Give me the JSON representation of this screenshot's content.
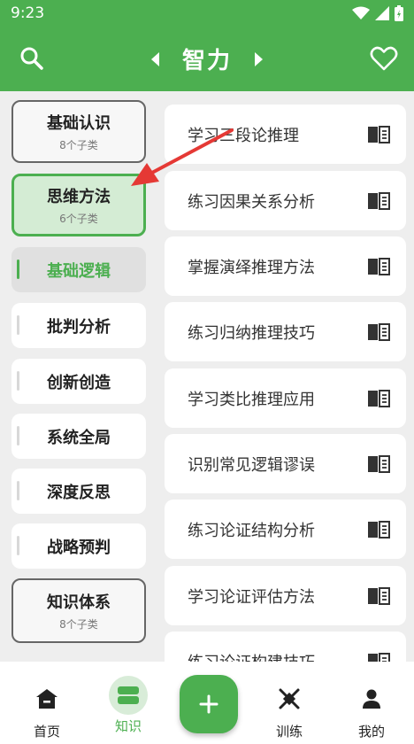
{
  "status": {
    "time": "9:23"
  },
  "header": {
    "title": "智力"
  },
  "sidebar": {
    "categories": [
      {
        "title": "基础认识",
        "subtitle": "8个子类"
      },
      {
        "title": "思维方法",
        "subtitle": "6个子类"
      },
      {
        "title": "知识体系",
        "subtitle": "8个子类"
      }
    ],
    "subcategories": [
      "基础逻辑",
      "批判分析",
      "创新创造",
      "系统全局",
      "深度反思",
      "战略预判"
    ]
  },
  "content": {
    "items": [
      "学习三段论推理",
      "练习因果关系分析",
      "掌握演绎推理方法",
      "练习归纳推理技巧",
      "学习类比推理应用",
      "识别常见逻辑谬误",
      "练习论证结构分析",
      "学习论证评估方法",
      "练习论证构建技巧"
    ]
  },
  "bottom_nav": {
    "items": [
      {
        "label": "首页",
        "icon": "home-icon"
      },
      {
        "label": "知识",
        "icon": "knowledge-icon"
      },
      {
        "label": "训练",
        "icon": "training-icon"
      },
      {
        "label": "我的",
        "icon": "profile-icon"
      }
    ],
    "fab_icon": "plus-icon"
  },
  "colors": {
    "primary": "#4caf50",
    "selected_bg": "#d4ecd4",
    "annotation": "#e53935"
  }
}
